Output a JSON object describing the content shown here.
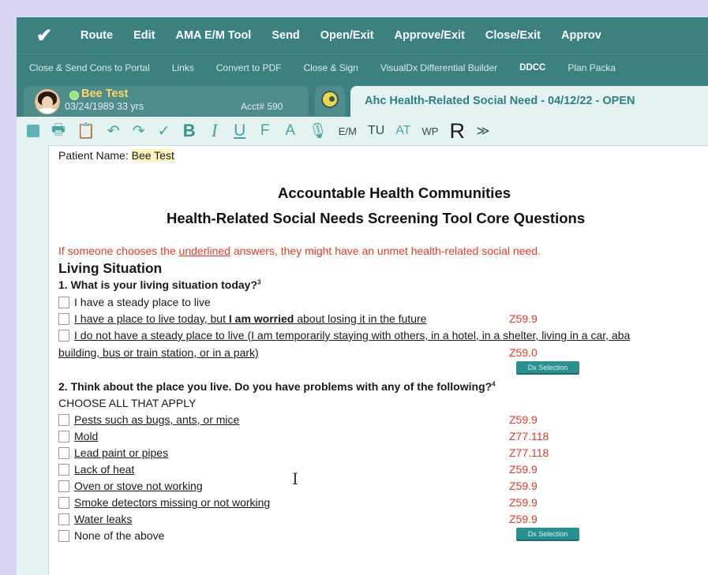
{
  "menu": {
    "items": [
      "Route",
      "Edit",
      "AMA E/M Tool",
      "Send",
      "Open/Exit",
      "Approve/Exit",
      "Close/Exit",
      "Approv"
    ]
  },
  "subbar": {
    "items": [
      "Close & Send Cons to Portal",
      "Links",
      "Convert to PDF",
      "Close & Sign",
      "VisualDx Differential Builder",
      "DDCC",
      "Plan Packa"
    ]
  },
  "patient_tab": {
    "name": "Bee Test",
    "dob_age": "03/24/1989  33 yrs",
    "acct": "Acct# 590"
  },
  "doc_tab": {
    "title": "Ahc Health-Related Social Need - 04/12/22 - OPEN"
  },
  "toolbar": {
    "bold": "B",
    "italic": "I",
    "underline": "U",
    "em": "E/M",
    "tu": "TU",
    "at": "AT",
    "wp": "WP",
    "r": "R",
    "more": "≫"
  },
  "document": {
    "patient_label": "Patient Name: ",
    "patient_name": "Bee Test",
    "title1": "Accountable Health Communities",
    "title2": "Health-Related Social Needs Screening Tool Core Questions",
    "note_before": "If someone chooses the ",
    "note_underlined": "underlined",
    "note_after": " answers, they might have an unmet health-related social need.",
    "section1": "Living Situation",
    "q1": "1. What is your living situation today?",
    "q1_sup": "3",
    "q1_opt1": "I have a steady place to live",
    "q1_opt2_a": "I have a place to live today, but ",
    "q1_opt2_b": "I am worried",
    "q1_opt2_c": " about losing it in the future",
    "q1_opt2_code": "Z59.9",
    "q1_opt3_line1": "I do not have a steady place to live (I am temporarily staying with others, in a hotel, in a shelter, living in a car, aba",
    "q1_opt3_line2": "building, bus or train station, or in a park)",
    "q1_opt3_code": "Z59.0",
    "dx_button": "Dx Selection",
    "q2": "2. Think about the place you live. Do you have problems with any of the following?",
    "q2_sup": "4",
    "q2_choose": "CHOOSE ALL THAT APPLY",
    "q2_options": [
      {
        "label": "Pests such as bugs, ants, or mice",
        "code": "Z59.9"
      },
      {
        "label": "Mold",
        "code": "Z77.118"
      },
      {
        "label": "Lead paint or pipes",
        "code": "Z77.118"
      },
      {
        "label": "Lack of heat",
        "code": "Z59.9"
      },
      {
        "label": "Oven or stove not working",
        "code": "Z59.9"
      },
      {
        "label": "Smoke detectors missing or not working",
        "code": "Z59.9"
      },
      {
        "label": "Water leaks",
        "code": "Z59.9"
      }
    ],
    "q2_none": "None of the above",
    "dx_button2": "Dx Selection"
  }
}
